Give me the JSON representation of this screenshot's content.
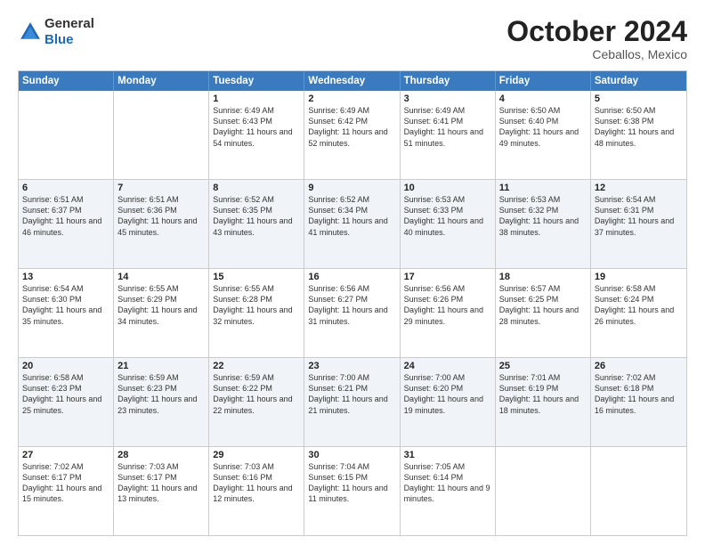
{
  "header": {
    "logo_general": "General",
    "logo_blue": "Blue",
    "month": "October 2024",
    "location": "Ceballos, Mexico"
  },
  "days_of_week": [
    "Sunday",
    "Monday",
    "Tuesday",
    "Wednesday",
    "Thursday",
    "Friday",
    "Saturday"
  ],
  "weeks": [
    [
      {
        "day": "",
        "info": ""
      },
      {
        "day": "",
        "info": ""
      },
      {
        "day": "1",
        "info": "Sunrise: 6:49 AM\nSunset: 6:43 PM\nDaylight: 11 hours and 54 minutes."
      },
      {
        "day": "2",
        "info": "Sunrise: 6:49 AM\nSunset: 6:42 PM\nDaylight: 11 hours and 52 minutes."
      },
      {
        "day": "3",
        "info": "Sunrise: 6:49 AM\nSunset: 6:41 PM\nDaylight: 11 hours and 51 minutes."
      },
      {
        "day": "4",
        "info": "Sunrise: 6:50 AM\nSunset: 6:40 PM\nDaylight: 11 hours and 49 minutes."
      },
      {
        "day": "5",
        "info": "Sunrise: 6:50 AM\nSunset: 6:38 PM\nDaylight: 11 hours and 48 minutes."
      }
    ],
    [
      {
        "day": "6",
        "info": "Sunrise: 6:51 AM\nSunset: 6:37 PM\nDaylight: 11 hours and 46 minutes."
      },
      {
        "day": "7",
        "info": "Sunrise: 6:51 AM\nSunset: 6:36 PM\nDaylight: 11 hours and 45 minutes."
      },
      {
        "day": "8",
        "info": "Sunrise: 6:52 AM\nSunset: 6:35 PM\nDaylight: 11 hours and 43 minutes."
      },
      {
        "day": "9",
        "info": "Sunrise: 6:52 AM\nSunset: 6:34 PM\nDaylight: 11 hours and 41 minutes."
      },
      {
        "day": "10",
        "info": "Sunrise: 6:53 AM\nSunset: 6:33 PM\nDaylight: 11 hours and 40 minutes."
      },
      {
        "day": "11",
        "info": "Sunrise: 6:53 AM\nSunset: 6:32 PM\nDaylight: 11 hours and 38 minutes."
      },
      {
        "day": "12",
        "info": "Sunrise: 6:54 AM\nSunset: 6:31 PM\nDaylight: 11 hours and 37 minutes."
      }
    ],
    [
      {
        "day": "13",
        "info": "Sunrise: 6:54 AM\nSunset: 6:30 PM\nDaylight: 11 hours and 35 minutes."
      },
      {
        "day": "14",
        "info": "Sunrise: 6:55 AM\nSunset: 6:29 PM\nDaylight: 11 hours and 34 minutes."
      },
      {
        "day": "15",
        "info": "Sunrise: 6:55 AM\nSunset: 6:28 PM\nDaylight: 11 hours and 32 minutes."
      },
      {
        "day": "16",
        "info": "Sunrise: 6:56 AM\nSunset: 6:27 PM\nDaylight: 11 hours and 31 minutes."
      },
      {
        "day": "17",
        "info": "Sunrise: 6:56 AM\nSunset: 6:26 PM\nDaylight: 11 hours and 29 minutes."
      },
      {
        "day": "18",
        "info": "Sunrise: 6:57 AM\nSunset: 6:25 PM\nDaylight: 11 hours and 28 minutes."
      },
      {
        "day": "19",
        "info": "Sunrise: 6:58 AM\nSunset: 6:24 PM\nDaylight: 11 hours and 26 minutes."
      }
    ],
    [
      {
        "day": "20",
        "info": "Sunrise: 6:58 AM\nSunset: 6:23 PM\nDaylight: 11 hours and 25 minutes."
      },
      {
        "day": "21",
        "info": "Sunrise: 6:59 AM\nSunset: 6:23 PM\nDaylight: 11 hours and 23 minutes."
      },
      {
        "day": "22",
        "info": "Sunrise: 6:59 AM\nSunset: 6:22 PM\nDaylight: 11 hours and 22 minutes."
      },
      {
        "day": "23",
        "info": "Sunrise: 7:00 AM\nSunset: 6:21 PM\nDaylight: 11 hours and 21 minutes."
      },
      {
        "day": "24",
        "info": "Sunrise: 7:00 AM\nSunset: 6:20 PM\nDaylight: 11 hours and 19 minutes."
      },
      {
        "day": "25",
        "info": "Sunrise: 7:01 AM\nSunset: 6:19 PM\nDaylight: 11 hours and 18 minutes."
      },
      {
        "day": "26",
        "info": "Sunrise: 7:02 AM\nSunset: 6:18 PM\nDaylight: 11 hours and 16 minutes."
      }
    ],
    [
      {
        "day": "27",
        "info": "Sunrise: 7:02 AM\nSunset: 6:17 PM\nDaylight: 11 hours and 15 minutes."
      },
      {
        "day": "28",
        "info": "Sunrise: 7:03 AM\nSunset: 6:17 PM\nDaylight: 11 hours and 13 minutes."
      },
      {
        "day": "29",
        "info": "Sunrise: 7:03 AM\nSunset: 6:16 PM\nDaylight: 11 hours and 12 minutes."
      },
      {
        "day": "30",
        "info": "Sunrise: 7:04 AM\nSunset: 6:15 PM\nDaylight: 11 hours and 11 minutes."
      },
      {
        "day": "31",
        "info": "Sunrise: 7:05 AM\nSunset: 6:14 PM\nDaylight: 11 hours and 9 minutes."
      },
      {
        "day": "",
        "info": ""
      },
      {
        "day": "",
        "info": ""
      }
    ]
  ],
  "alt_rows": [
    1,
    3
  ]
}
